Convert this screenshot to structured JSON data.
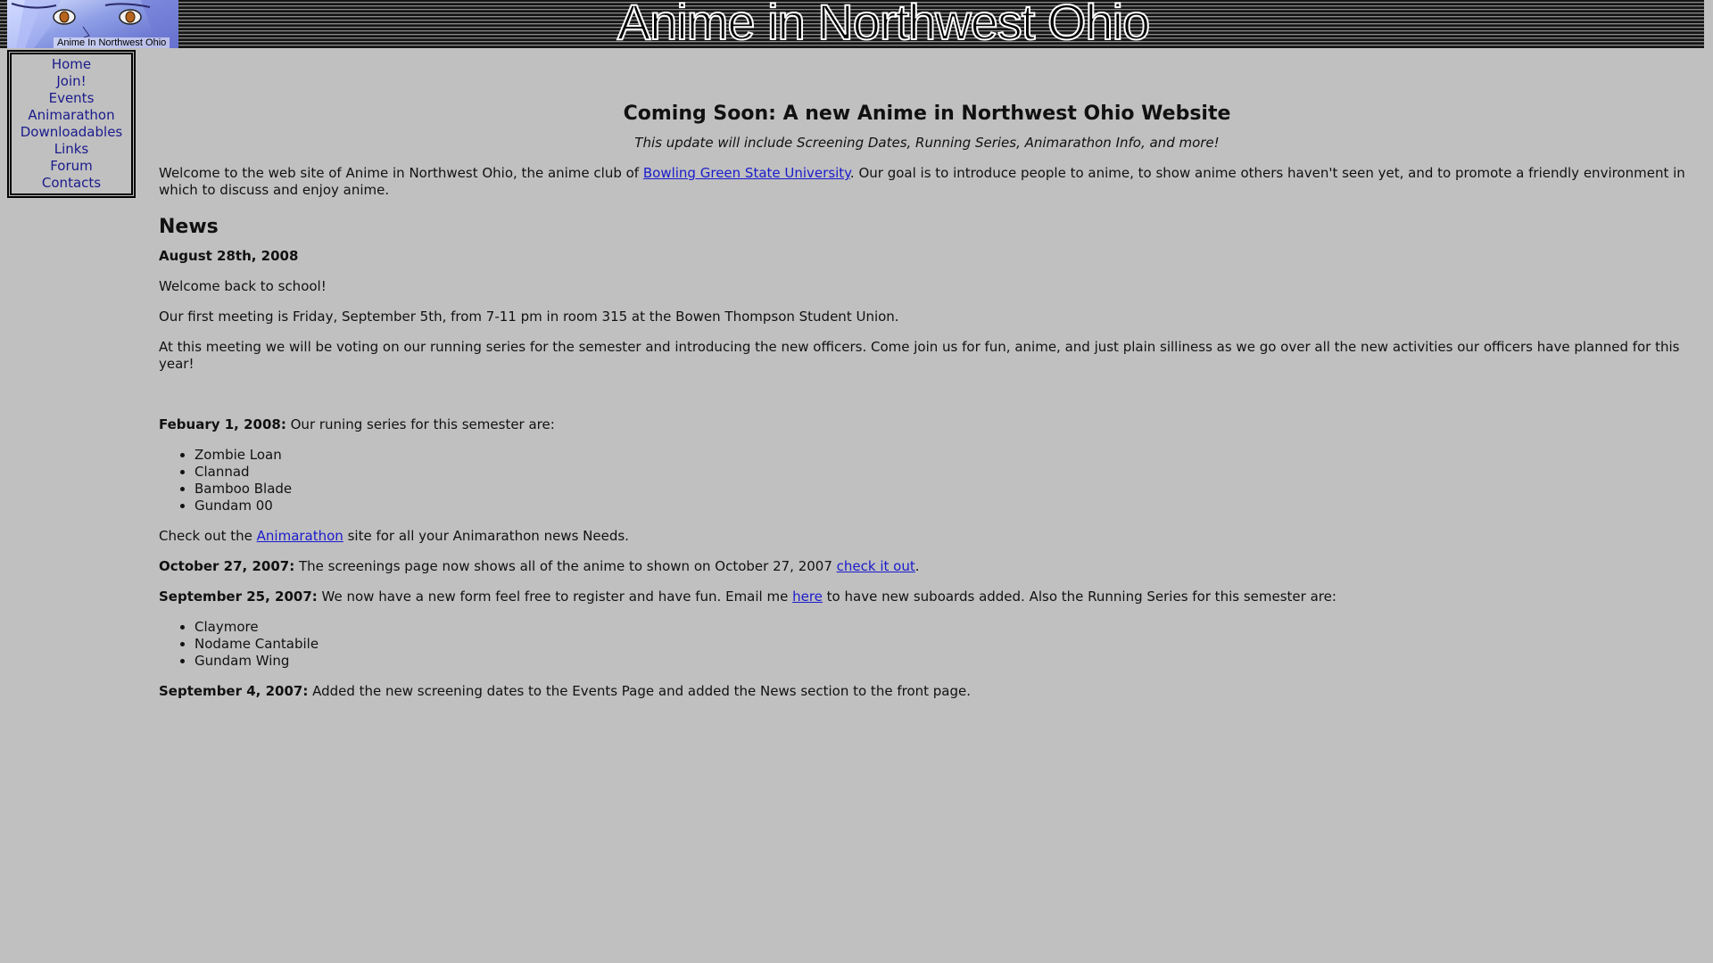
{
  "header": {
    "logo_caption": "Anime In Northwest Ohio",
    "title": "Anime in Northwest Ohio"
  },
  "nav": {
    "items": [
      "Home",
      "Join!",
      "Events",
      "Animarathon",
      "Downloadables",
      "Links",
      "Forum",
      "Contacts"
    ]
  },
  "main": {
    "coming_soon": "Coming Soon: A new Anime in Northwest Ohio Website",
    "update_note": "This update will include Screening Dates, Running Series, Animarathon Info, and more!",
    "welcome_pre": "Welcome to the web site of Anime in Northwest Ohio, the anime club of ",
    "welcome_link": "Bowling Green State University",
    "welcome_post": ". Our goal is to introduce people to anime, to show anime others haven't seen yet, and to promote a friendly environment in which to discuss and enjoy anime.",
    "news_heading": "News",
    "news1": {
      "date": "August 28th, 2008",
      "p1": "Welcome back to school!",
      "p2": "Our first meeting is Friday, September 5th, from 7-11 pm in room 315 at the Bowen Thompson Student Union.",
      "p3": "At this meeting we will be voting on our running series for the semester and introducing the new officers. Come join us for fun, anime, and just plain silliness as we go over all the new activities our officers have planned for this year!"
    },
    "news2": {
      "date": "Febuary 1, 2008:",
      "text": " Our runing series for this semester are:",
      "series": [
        "Zombie Loan",
        "Clannad",
        "Bamboo Blade",
        "Gundam 00"
      ]
    },
    "animarathon": {
      "pre": "Check out the ",
      "link": "Animarathon",
      "post": " site for all your Animarathon news Needs."
    },
    "news3": {
      "date": "October 27, 2007:",
      "text": " The screenings page now shows all of the anime to shown on October 27, 2007 ",
      "link": "check it out",
      "post": "."
    },
    "news4": {
      "date": "September 25, 2007:",
      "text": " We now have a new form feel free to register and have fun. Email me ",
      "link": "here",
      "post": " to have new suboards added. Also the Running Series for this semester are:",
      "series": [
        "Claymore",
        "Nodame Cantabile",
        "Gundam Wing"
      ]
    },
    "news5": {
      "date": "September 4, 2007:",
      "text": " Added the new screening dates to the Events Page and added the News section to the front page."
    }
  },
  "colors": {
    "background": "#c0c0c0",
    "nav_link": "#1a1a8c",
    "body_link": "#1a1acc"
  }
}
